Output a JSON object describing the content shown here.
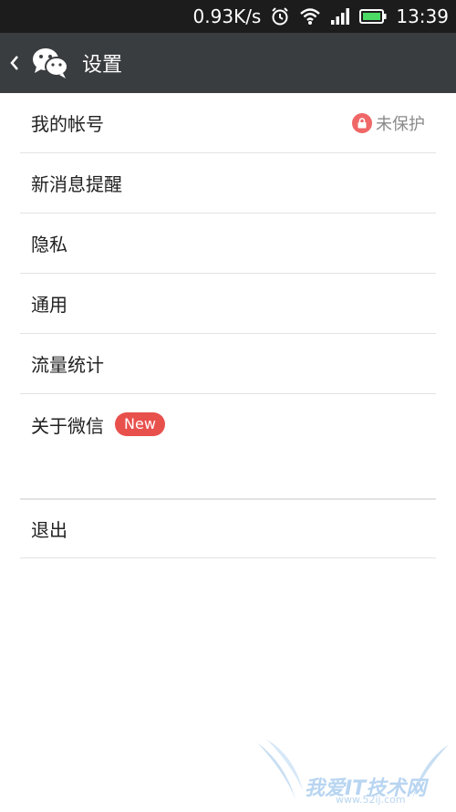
{
  "status_bar": {
    "net_speed": "0.93K/s",
    "time": "13:39",
    "icons": [
      "alarm-icon",
      "wifi-icon",
      "signal-icon",
      "battery-icon"
    ]
  },
  "header": {
    "title": "设置",
    "back_icon": "chevron-left-icon",
    "logo_icon": "wechat-logo-icon"
  },
  "settings": {
    "items": [
      {
        "label": "我的帐号",
        "status": "未保护",
        "status_icon": "lock-icon"
      },
      {
        "label": "新消息提醒"
      },
      {
        "label": "隐私"
      },
      {
        "label": "通用"
      },
      {
        "label": "流量统计"
      },
      {
        "label": "关于微信",
        "badge": "New"
      }
    ],
    "logout": "退出"
  },
  "watermark": {
    "text": "我爱IT技术网",
    "sub": "www.52ij.com"
  },
  "colors": {
    "header_bg": "#3a3d40",
    "status_bg": "#1c1c1c",
    "badge_red": "#e8504c",
    "battery_green": "#4cd964"
  }
}
